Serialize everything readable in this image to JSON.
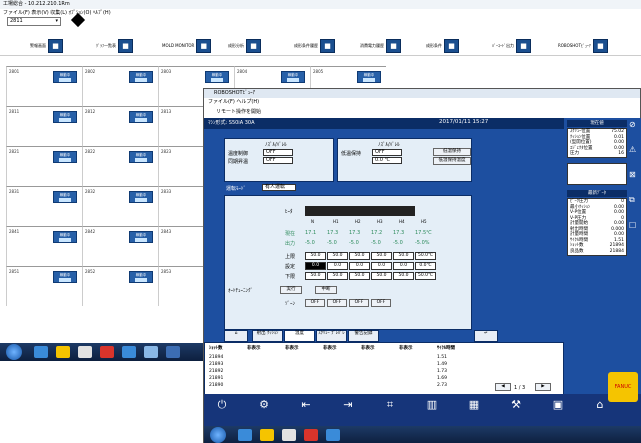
{
  "back_window": {
    "title": "工場総合 - 10.212.210.1Rm",
    "menu": "ファイル(F)  表示(V)  収集(L)  ｵﾌﾟｼｮﾝ(O)  ﾍﾙﾌﾟ(H)",
    "selector_value": "2811",
    "toolbar": [
      {
        "label": "警報画面",
        "icon": "alarm-icon"
      },
      {
        "label": "ｸﾞﾗﾌ一覧表",
        "icon": "list-icon"
      },
      {
        "label": "MOLD MONITOR",
        "icon": "monitor-icon"
      },
      {
        "label": "成形分析",
        "icon": "analysis-icon"
      },
      {
        "label": "成形条件履歴",
        "icon": "history-icon"
      },
      {
        "label": "消費電力履歴",
        "icon": "power-icon"
      },
      {
        "label": "成形条件",
        "icon": "condition-icon"
      },
      {
        "label": "ﾊﾞｰｺｰﾄﾞ出力",
        "icon": "barcode-icon"
      },
      {
        "label": "ROBOSHOTﾋﾞｭｰｱ",
        "icon": "viewer-icon"
      }
    ],
    "cells": [
      {
        "id": "2801",
        "status": "稼動中"
      },
      {
        "id": "2802",
        "status": "稼動中"
      },
      {
        "id": "2803",
        "status": "稼動中"
      },
      {
        "id": "2804",
        "status": "稼動中"
      },
      {
        "id": "2805",
        "status": "稼動中"
      },
      {
        "id": "2811",
        "status": "稼動中"
      },
      {
        "id": "2812",
        "status": "稼動中"
      },
      {
        "id": "2813",
        "status": "稼動中"
      },
      {
        "id": "2814",
        "status": "稼動中"
      },
      {
        "id": "2815",
        "status": "稼動中"
      },
      {
        "id": "2821",
        "status": "稼動中"
      },
      {
        "id": "2822",
        "status": "稼動中"
      },
      {
        "id": "2823",
        "status": "稼動中"
      },
      {
        "id": "2824",
        "status": "稼動中"
      },
      {
        "id": "2825",
        "status": "稼動中"
      },
      {
        "id": "2831",
        "status": "稼動中"
      },
      {
        "id": "2832",
        "status": "稼動中"
      },
      {
        "id": "2833",
        "status": "稼動中"
      },
      {
        "id": "2834",
        "status": "稼動中"
      },
      {
        "id": "2835",
        "status": "稼動中"
      },
      {
        "id": "2841",
        "status": "稼動中"
      },
      {
        "id": "2842",
        "status": "稼動中"
      },
      {
        "id": "2843",
        "status": "稼動中"
      },
      {
        "id": "2844",
        "status": "稼動中"
      },
      {
        "id": "2845",
        "status": "稼動中"
      },
      {
        "id": "2851",
        "status": "稼動中"
      },
      {
        "id": "2852",
        "status": "稼動中"
      },
      {
        "id": "2853",
        "status": "稼動中"
      },
      {
        "id": "2854",
        "status": "稼動中"
      },
      {
        "id": "2855",
        "status": "稼動中"
      }
    ],
    "right_cells": [
      "2802",
      "2806",
      "2806",
      "2806",
      "2806",
      "2808",
      "2810",
      "2811",
      "2812"
    ]
  },
  "front_window": {
    "title": "ROBOSHOTﾋﾞｭｰｱ",
    "menu": "ファイル(F)  ヘルプ(H)",
    "remote_btn": "リモート操作を開始",
    "head_left": "ﾏｼﾝ形式: S50iA 30A",
    "head_right": "2017/01/11 15:27",
    "heater": {
      "section_title": "ﾉｽﾞﾙ/ﾊﾞﾚﾙ",
      "temp_ctrl_label": "温度制御",
      "temp_ctrl_value": "OFF",
      "sync_label": "同期昇温",
      "sync_value": "OFF",
      "low_title": "ﾉｽﾞﾙ/ﾊﾞﾚﾙ",
      "low_label": "低温保持",
      "low_value": "OFF",
      "low_temp": "0.0 ℃",
      "low_btn1": "低温保持",
      "low_btn2": "低温保持温度",
      "mode_label": "運転ﾓｰﾄﾞ",
      "mode_value": "有人運転",
      "heater_label": "ﾋｰﾀ",
      "zones": [
        "N",
        "H1",
        "H2",
        "H3",
        "H4",
        "H5"
      ],
      "current_label": "現在",
      "current": [
        "17.1",
        "17.3",
        "17.3",
        "17.2",
        "17.3",
        "17.5℃"
      ],
      "output_label": "出力",
      "output": [
        "-5.0",
        "-5.0",
        "-5.0",
        "-5.0",
        "-5.0",
        "-5.0%"
      ],
      "upper_label": "上限",
      "upper": [
        "50.0",
        "50.0",
        "50.0",
        "50.0",
        "50.0",
        "50.0℃"
      ],
      "set_label": "設定",
      "set": [
        "0.0",
        "0.0",
        "0.0",
        "0.0",
        "0.0",
        "0.0℃"
      ],
      "lower_label": "下限",
      "lower": [
        "50.0",
        "50.0",
        "50.0",
        "50.0",
        "50.0",
        "50.0℃"
      ],
      "tuning_label": "ｵｰﾄﾁｭｰﾆﾝｸﾞ",
      "exec_btn": "実行",
      "stop_btn": "中断",
      "zone_off_label": "ｿﾞｰﾝ",
      "zone_off": [
        "OFF",
        "OFF",
        "OFF",
        "OFF"
      ]
    },
    "side": {
      "current_title": "現在値",
      "current_rows": [
        {
          "k": "ｽｸﾘｭｰ位置",
          "v": "75.02"
        },
        {
          "k": "ｸｯｼｮﾝ位置",
          "v": "0.01"
        },
        {
          "k": "(型開位置)",
          "v": "0.00"
        },
        {
          "k": "ｴｼﾞｪｸﾀ位置",
          "v": "0.00"
        },
        {
          "k": "圧力",
          "v": "16"
        }
      ],
      "monitor_title": "最新ﾃﾞｰﾀ",
      "monitor_rows": [
        {
          "k": "ﾋﾟｰｸ圧力",
          "v": "0"
        },
        {
          "k": "最小ｸｯｼｮﾝ",
          "v": "0.00"
        },
        {
          "k": "V-P位置",
          "v": "0.00"
        },
        {
          "k": "V-P圧力",
          "v": "0"
        },
        {
          "k": "計量開始",
          "v": "0.00"
        },
        {
          "k": "射出時間",
          "v": "0.000"
        },
        {
          "k": "計量時間",
          "v": "0.00"
        },
        {
          "k": "ｻｲｸﾙ時間",
          "v": "1.51"
        },
        {
          "k": "ｼｮｯﾄ数",
          "v": "21894"
        },
        {
          "k": "良品数",
          "v": "21884"
        }
      ]
    },
    "tabs": [
      "射出 ｸｯｼｮﾝ",
      "温度",
      "ｽｸﾘｭｰ ﾌﾟﾚﾊﾟﾚ",
      "警告記録"
    ],
    "table": {
      "headers": [
        "ｼｮｯﾄ数",
        "非表示",
        "非表示",
        "非表示",
        "非表示",
        "非表示",
        "ｻｲｸﾙ時間"
      ],
      "rows": [
        [
          "21894",
          "1.51"
        ],
        [
          "21893",
          "1.49"
        ],
        [
          "21892",
          "1.73"
        ],
        [
          "21891",
          "1.69"
        ],
        [
          "21890",
          "2.73"
        ]
      ],
      "page": "1 / 3"
    },
    "bottom_buttons": [
      "power",
      "gear",
      "inject",
      "eject",
      "mold",
      "heater",
      "chart",
      "tools",
      "monitor",
      "nav"
    ]
  }
}
